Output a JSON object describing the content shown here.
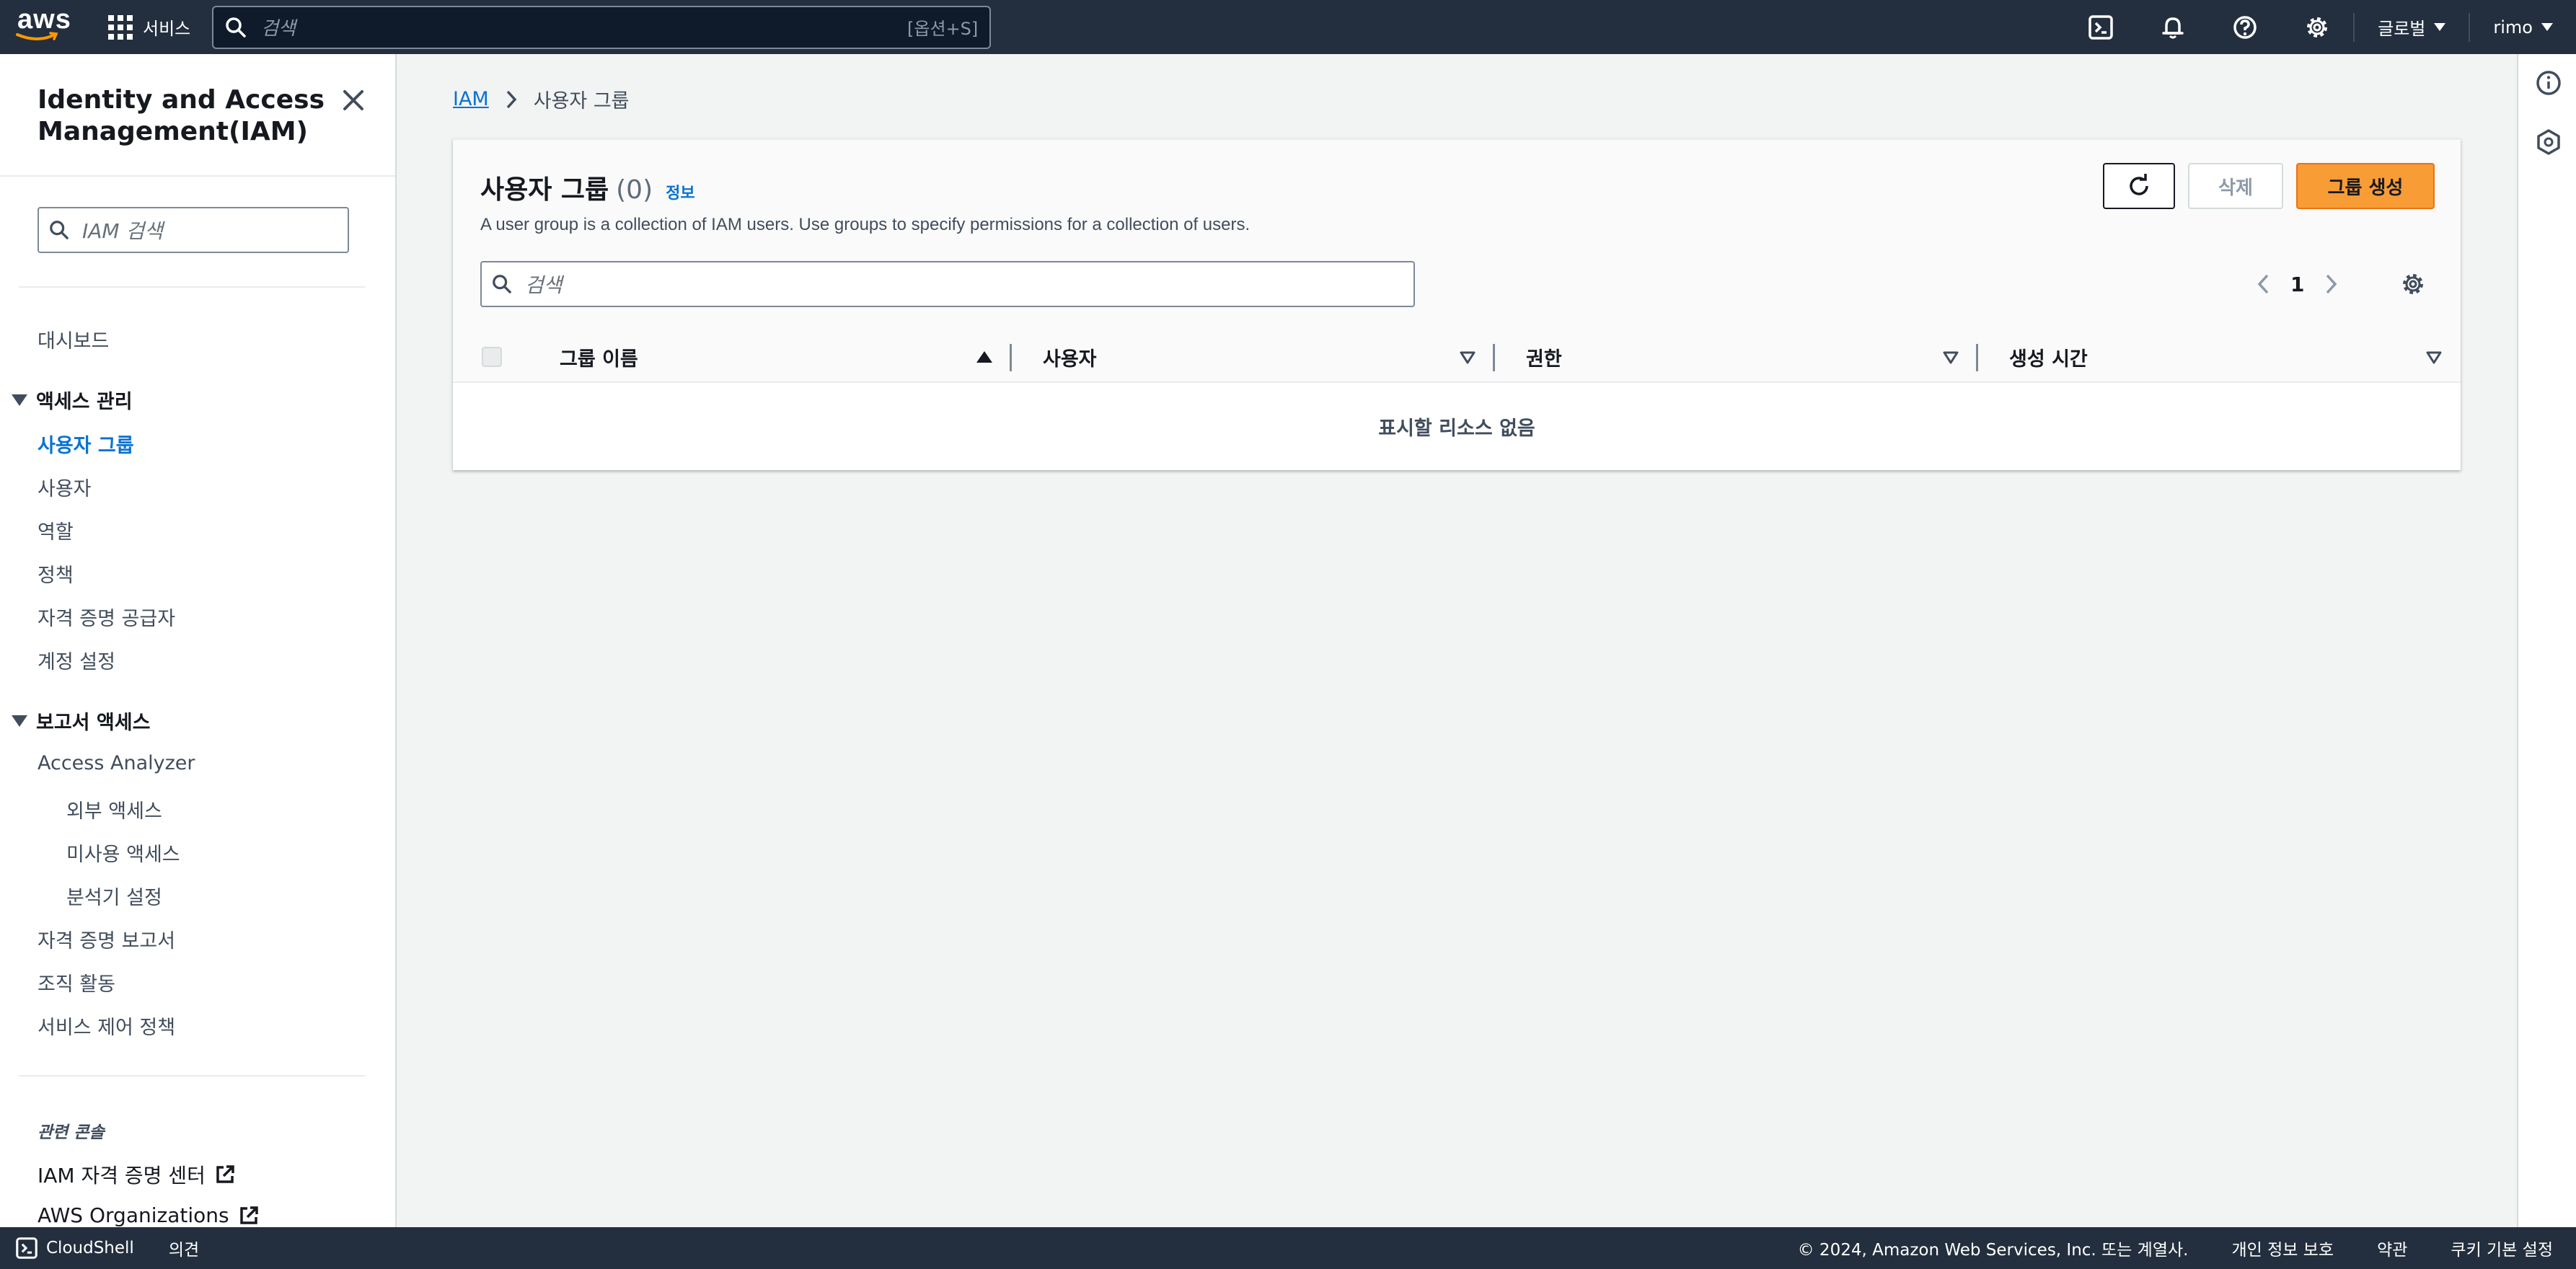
{
  "topnav": {
    "logo_text": "aws",
    "services_label": "서비스",
    "search_placeholder": "검색",
    "search_shortcut": "[옵션+S]",
    "region_label": "글로벌",
    "user_label": "rimo"
  },
  "sidebar": {
    "title": "Identity and Access Management(IAM)",
    "search_placeholder": "IAM 검색",
    "dashboard": "대시보드",
    "section_access": "액세스 관리",
    "access_items": [
      "사용자 그룹",
      "사용자",
      "역할",
      "정책",
      "자격 증명 공급자",
      "계정 설정"
    ],
    "active_item": "사용자 그룹",
    "section_reports": "보고서 액세스",
    "access_analyzer": "Access Analyzer",
    "analyzer_items": [
      "외부 액세스",
      "미사용 액세스",
      "분석기 설정"
    ],
    "report_items": [
      "자격 증명 보고서",
      "조직 활동",
      "서비스 제어 정책"
    ],
    "related_title": "관련 콘솔",
    "related_items": [
      "IAM 자격 증명 센터",
      "AWS Organizations"
    ]
  },
  "breadcrumb": {
    "root": "IAM",
    "current": "사용자 그룹"
  },
  "panel": {
    "title": "사용자 그룹",
    "count": "(0)",
    "info_link": "정보",
    "description": "A user group is a collection of IAM users. Use groups to specify permissions for a collection of users.",
    "delete_label": "삭제",
    "create_label": "그룹 생성",
    "search_placeholder": "검색",
    "page_number": "1",
    "columns": [
      "그룹 이름",
      "사용자",
      "권한",
      "생성 시간"
    ],
    "empty_text": "표시할 리소스 없음"
  },
  "footer": {
    "cloudshell": "CloudShell",
    "feedback": "의견",
    "copyright": "© 2024, Amazon Web Services, Inc. 또는 계열사.",
    "privacy": "개인 정보 보호",
    "terms": "약관",
    "cookies": "쿠키 기본 설정"
  },
  "colors": {
    "nav_bg": "#232f3e",
    "link": "#0972d3",
    "primary_button": "#f89c35",
    "page_bg": "#f2f3f3"
  },
  "icons": [
    "aws-smile-icon",
    "grid-icon",
    "search-icon",
    "cloudshell-icon",
    "bell-icon",
    "help-icon",
    "gear-icon",
    "close-icon",
    "chevron-right-icon",
    "refresh-icon",
    "external-link-icon",
    "info-icon",
    "hexagon-icon"
  ]
}
